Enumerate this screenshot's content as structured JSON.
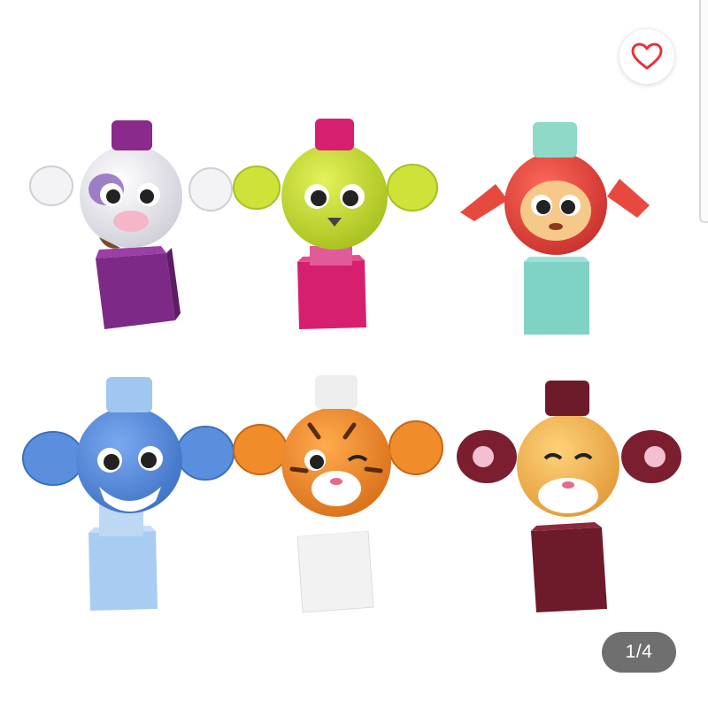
{
  "gallery": {
    "pager": {
      "current": 1,
      "total": 4,
      "label": "1/4"
    },
    "favorite": {
      "icon": "heart-outline-icon",
      "color": "#e8323c"
    },
    "image": {
      "figures": [
        {
          "name": "cow-figure",
          "base": "#7d2a86",
          "cap": "#8a2a8a",
          "head": "#ecebf2"
        },
        {
          "name": "green-figure",
          "base": "#d6206f",
          "cap": "#d6206f",
          "head": "#c6dc2e"
        },
        {
          "name": "monkey-figure",
          "base": "#7fd3c4",
          "cap": "#8fd9c8",
          "head": "#e8493f"
        },
        {
          "name": "elephant-figure",
          "base": "#a9cdf2",
          "cap": "#9fc7f0",
          "head": "#5a8fdd"
        },
        {
          "name": "tiger-figure",
          "base": "#f2f2f2",
          "cap": "#eeeeee",
          "head": "#f08c2a"
        },
        {
          "name": "cat-figure",
          "base": "#6d1a2a",
          "cap": "#6d1a2a",
          "head": "#f3b154"
        }
      ]
    }
  }
}
